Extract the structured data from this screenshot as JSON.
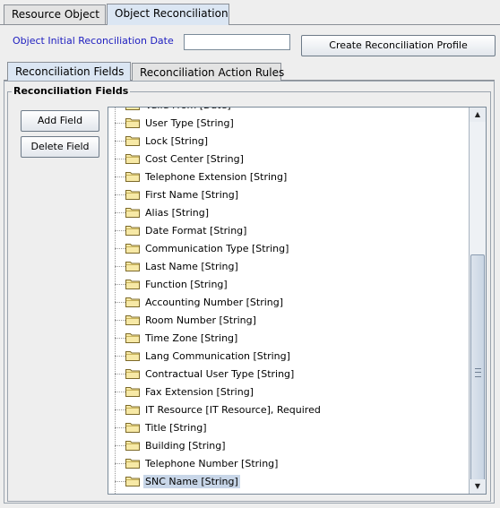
{
  "tabs": [
    "Resource Object",
    "Object Reconciliation"
  ],
  "selected_tab": "Object Reconciliation",
  "object_initial_reconciliation_date": {
    "label": "Object Initial Reconciliation Date",
    "value": ""
  },
  "create_profile_button": "Create Reconciliation Profile",
  "sub_tabs": [
    "Reconciliation Fields",
    "Reconciliation Action Rules"
  ],
  "group_title": "Reconciliation Fields",
  "add_field_button": "Add Field",
  "delete_field_button": "Delete Field",
  "tree_items": [
    "Valid From [Date]",
    "User Type [String]",
    "Lock [String]",
    "Cost Center [String]",
    "Telephone Extension [String]",
    "First Name [String]",
    "Alias [String]",
    "Date Format [String]",
    "Communication Type [String]",
    "Last Name [String]",
    "Function [String]",
    "Accounting Number [String]",
    "Room Number [String]",
    "Time Zone [String]",
    "Lang Communication [String]",
    "Contractual User Type [String]",
    "Fax Extension [String]",
    "IT Resource [IT Resource], Required",
    "Title [String]",
    "Building [String]",
    "Telephone Number [String]",
    "SNC Name [String]"
  ],
  "selected_tree_item": "SNC Name [String]",
  "scrollbar_position": 0.9,
  "icons": {
    "folder": "folder-icon",
    "scroll_up": "scroll-up-arrow-icon",
    "scroll_down": "scroll-down-arrow-icon"
  },
  "colors": {
    "tab_selected_bg": "#dbe6f3",
    "date_label": "#2020c0",
    "selection_bg": "#c8d6e8",
    "folder_fill": "#f7e9a6"
  }
}
